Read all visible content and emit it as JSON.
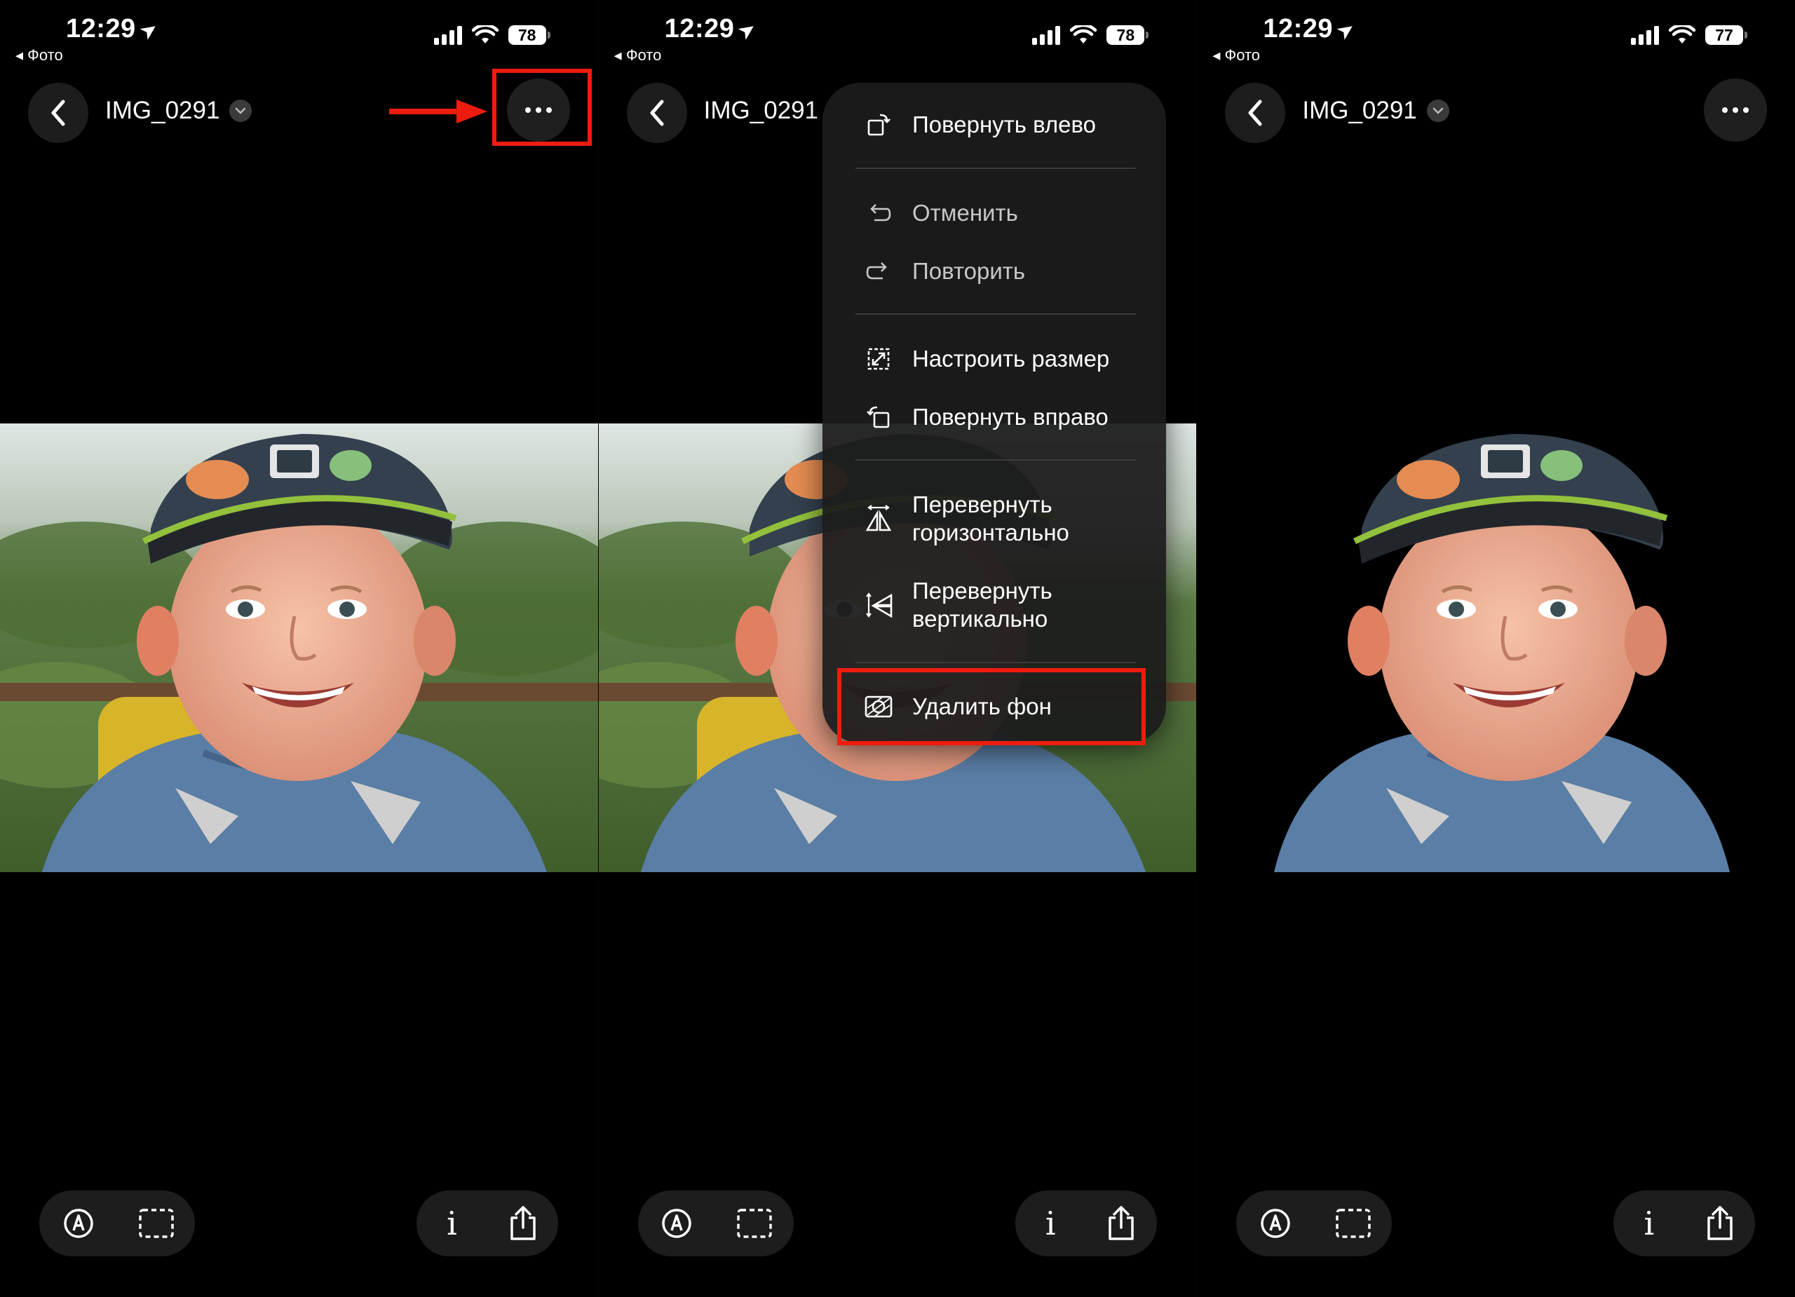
{
  "status_bar": {
    "time": "12:29",
    "back_app": "◂ Фото",
    "battery_panels": [
      "78",
      "78",
      "77"
    ]
  },
  "nav": {
    "title": "IMG_0291"
  },
  "menu": {
    "items": [
      {
        "label": "Повернуть влево",
        "icon": "rotate-left-icon",
        "enabled": true
      },
      {
        "label": "Отменить",
        "icon": "undo-icon",
        "enabled": false
      },
      {
        "label": "Повторить",
        "icon": "redo-icon",
        "enabled": false
      },
      {
        "label": "Настроить размер",
        "icon": "resize-icon",
        "enabled": true
      },
      {
        "label": "Повернуть вправо",
        "icon": "rotate-right-icon",
        "enabled": true
      },
      {
        "label_line1": "Перевернуть",
        "label_line2": "горизонтально",
        "icon": "flip-horizontal-icon",
        "enabled": true
      },
      {
        "label_line1": "Перевернуть",
        "label_line2": "вертикально",
        "icon": "flip-vertical-icon",
        "enabled": true
      },
      {
        "label": "Удалить фон",
        "icon": "remove-background-icon",
        "enabled": true
      }
    ]
  },
  "toolbar": {
    "left": [
      "markup-icon",
      "selection-icon"
    ],
    "right": [
      "info-icon",
      "share-icon"
    ],
    "info_glyph": "i"
  },
  "colors": {
    "accent_highlight": "#ee1c0f",
    "background": "#000000",
    "button_bg": "#1d1d1d"
  }
}
